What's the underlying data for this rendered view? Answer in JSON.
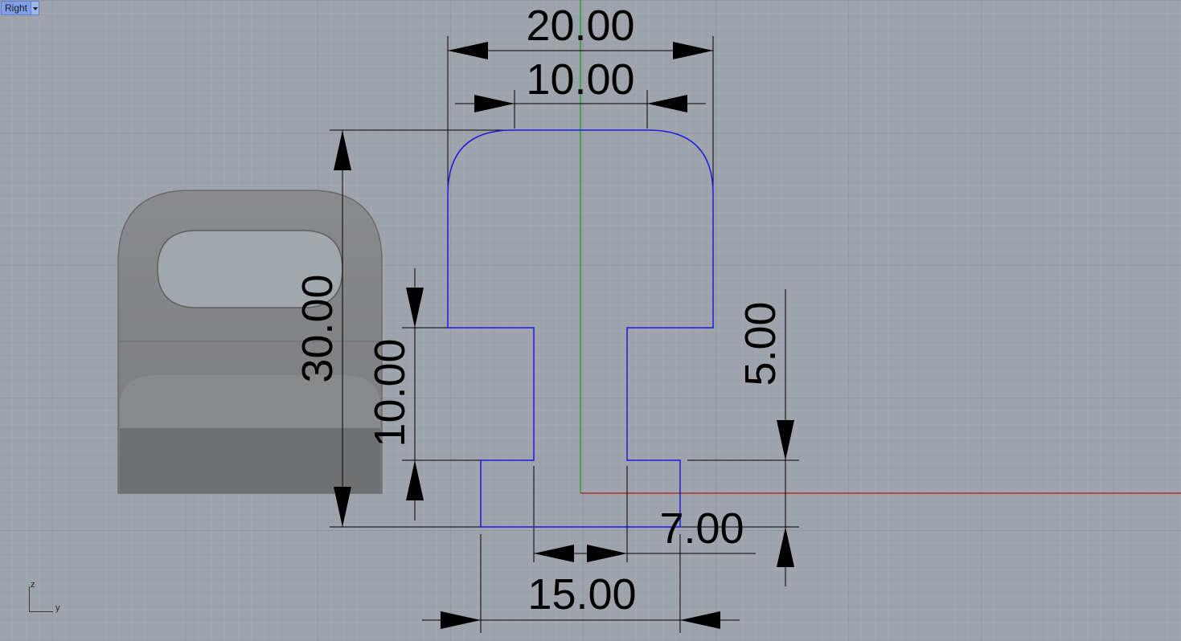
{
  "viewport": {
    "view_name": "Right",
    "view_menu_icon": "chevron-down-icon"
  },
  "axis_icon": {
    "vertical_axis": "z",
    "horizontal_axis": "y"
  },
  "colors": {
    "background": "#9ea3ab",
    "grid_minor": "#a7acb3",
    "grid_major": "#8d9198",
    "curve": "#1a1ae6",
    "world_y_axis": "#b03030",
    "world_z_axis": "#2f9a2f",
    "dimension": "#000000",
    "part_render": "#7c7d7f"
  },
  "dimensions": {
    "top_width": "20.00",
    "neck_width": "10.00",
    "total_height": "30.00",
    "left_step_height": "10.00",
    "right_step_height": "5.00",
    "bottom_offset": "7.00",
    "bottom_width": "15.00"
  }
}
